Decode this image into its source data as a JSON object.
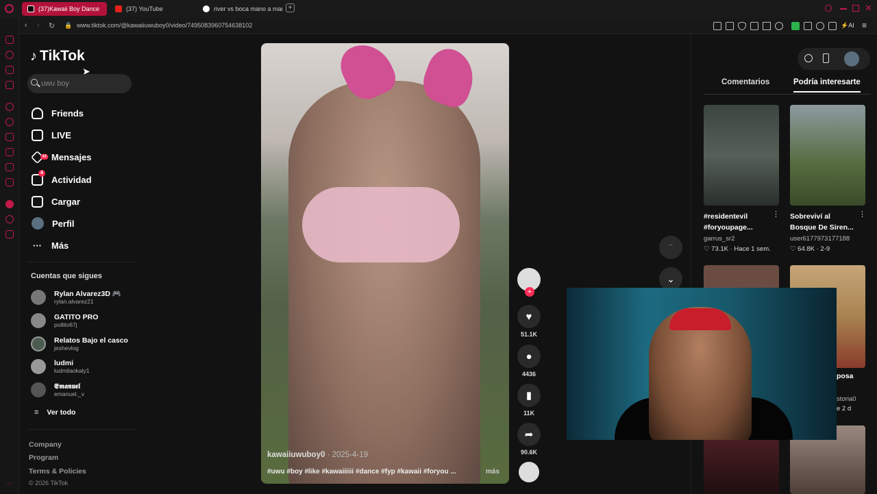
{
  "browser": {
    "tabs": [
      {
        "title": "(37)Kawaii Boy Dance",
        "active": true
      },
      {
        "title": "(37) YouTube",
        "active": false
      },
      {
        "title": "river vs boca mano a mano",
        "active": false
      }
    ],
    "url": "www.tiktok.com/@kawaiiuwuboy0/video/7495083960754638102",
    "toolbar_ai": "AI"
  },
  "sidebar": {
    "logo": "TikTok",
    "search_placeholder": "uwu boy",
    "nav": [
      {
        "label": "Friends",
        "icon": "friends-icon"
      },
      {
        "label": "LIVE",
        "icon": "live-icon"
      },
      {
        "label": "Mensajes",
        "icon": "messages-icon",
        "badge": "33"
      },
      {
        "label": "Actividad",
        "icon": "activity-icon",
        "badge": "4"
      },
      {
        "label": "Cargar",
        "icon": "upload-icon"
      },
      {
        "label": "Perfil",
        "icon": "profile-avatar"
      },
      {
        "label": "Más",
        "icon": "more-icon"
      }
    ],
    "following_title": "Cuentas que sigues",
    "following": [
      {
        "name": "Rylan Alvarez3D 🎮",
        "user": "rylan.alvarez21"
      },
      {
        "name": "GATITO PRO",
        "user": "pollito67j"
      },
      {
        "name": "Relatos Bajo el casco",
        "user": "jeshevlog"
      },
      {
        "name": "ludmi",
        "user": "ludmilaokaly1"
      },
      {
        "name": "𝕰𝖒𝖆𝖓𝖚𝖊𝖑",
        "user": "emanuel._v"
      }
    ],
    "see_all": "Ver todo",
    "footer": [
      "Company",
      "Program",
      "Terms & Policies"
    ],
    "copyright": "© 2026 TikTok"
  },
  "video": {
    "author": "kawaiiuwuboy0",
    "date": "· 2025-4-19",
    "caption": "#uwu #boy #like #kawaiiiiii #dance #fyp #kawaii #foryou ...",
    "more": "más"
  },
  "actions": {
    "likes": "51.1K",
    "comments": "4436",
    "saves": "11K",
    "shares": "90.6K"
  },
  "right_panel": {
    "tabs": [
      "Comentarios",
      "Podría interesarte"
    ],
    "cards": [
      {
        "title": "#residentevil #foryoupage...",
        "author": "garrus_sr2",
        "stats": "♡ 73.1K · Hace 1 sem."
      },
      {
        "title": "Sobreviví al Bosque De Siren...",
        "author": "user6177973177188",
        "stats": "♡ 64.8K · 2-9"
      }
    ],
    "partial_text": [
      "posa",
      "storia0",
      "e 2 d"
    ]
  }
}
